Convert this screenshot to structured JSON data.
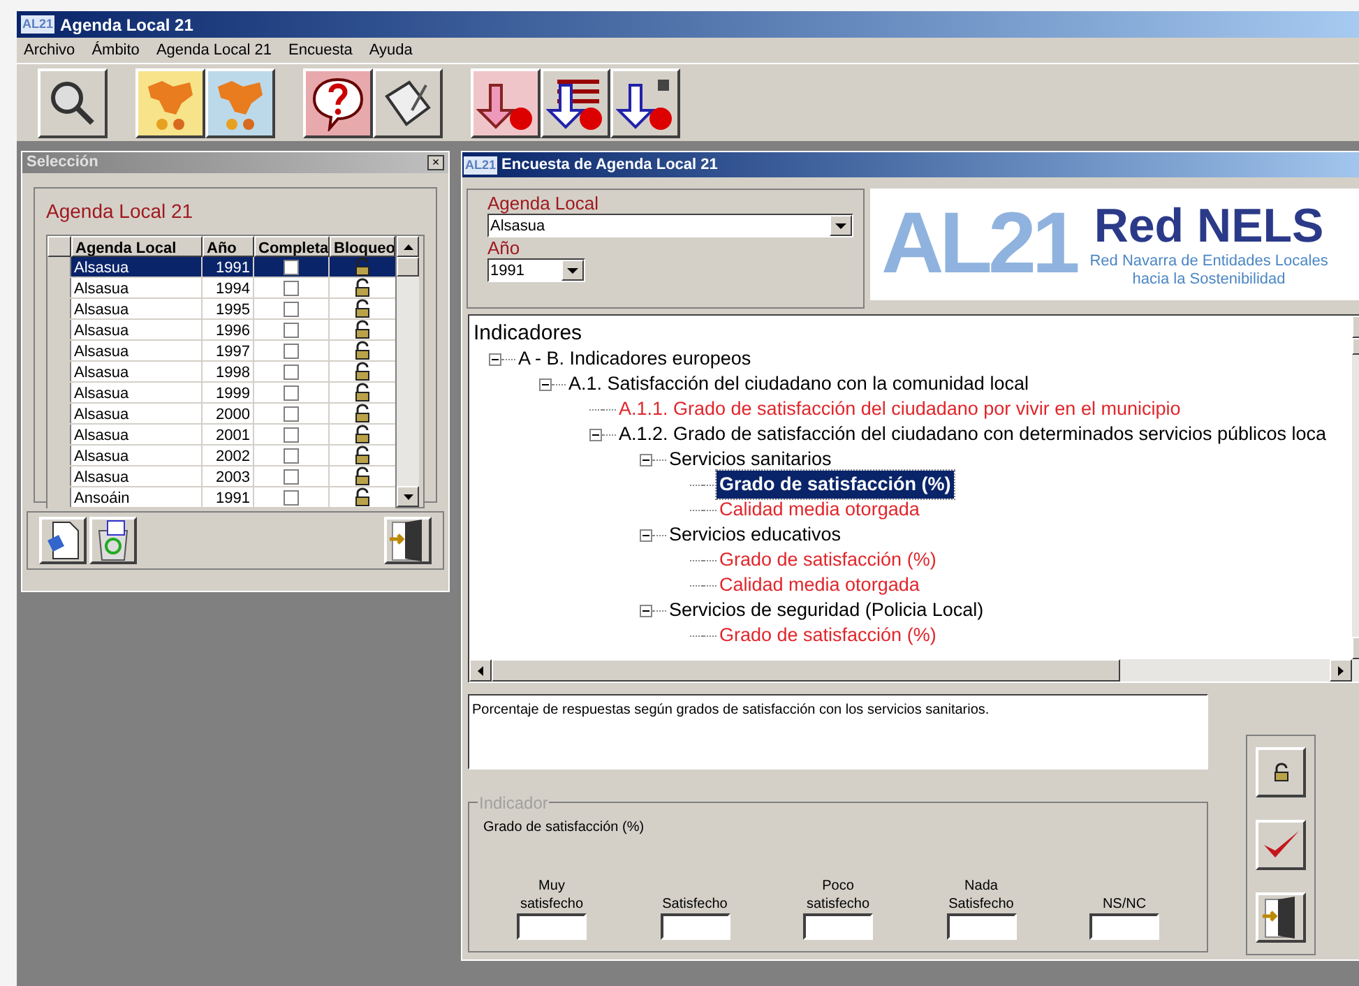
{
  "window": {
    "title": "Agenda Local 21",
    "logo": "AL21"
  },
  "menu": [
    "Archivo",
    "Ámbito",
    "Agenda Local 21",
    "Encuesta",
    "Ayuda"
  ],
  "selection_panel": {
    "title": "Selección",
    "close": "×",
    "group_title": "Agenda Local 21",
    "columns": [
      "Agenda Local",
      "Año",
      "Completa",
      "Bloqueo"
    ],
    "rows": [
      {
        "name": "Alsasua",
        "year": "1991",
        "complete": false,
        "locked": false,
        "selected": true
      },
      {
        "name": "Alsasua",
        "year": "1994",
        "complete": false,
        "locked": false,
        "selected": false
      },
      {
        "name": "Alsasua",
        "year": "1995",
        "complete": false,
        "locked": false,
        "selected": false
      },
      {
        "name": "Alsasua",
        "year": "1996",
        "complete": false,
        "locked": false,
        "selected": false
      },
      {
        "name": "Alsasua",
        "year": "1997",
        "complete": false,
        "locked": false,
        "selected": false
      },
      {
        "name": "Alsasua",
        "year": "1998",
        "complete": false,
        "locked": false,
        "selected": false
      },
      {
        "name": "Alsasua",
        "year": "1999",
        "complete": false,
        "locked": false,
        "selected": false
      },
      {
        "name": "Alsasua",
        "year": "2000",
        "complete": false,
        "locked": false,
        "selected": false
      },
      {
        "name": "Alsasua",
        "year": "2001",
        "complete": false,
        "locked": false,
        "selected": false
      },
      {
        "name": "Alsasua",
        "year": "2002",
        "complete": false,
        "locked": false,
        "selected": false
      },
      {
        "name": "Alsasua",
        "year": "2003",
        "complete": false,
        "locked": false,
        "selected": false
      },
      {
        "name": "Ansoáin",
        "year": "1991",
        "complete": false,
        "locked": false,
        "selected": false
      }
    ]
  },
  "survey_window": {
    "title": "Encuesta de Agenda Local 21",
    "logo": "AL21",
    "agenda_label": "Agenda Local",
    "agenda_value": "Alsasua",
    "year_label": "Año",
    "year_value": "1991",
    "banner": {
      "mark": "AL21",
      "name": "Red NELS",
      "line1": "Red Navarra de Entidades Locales",
      "line2": "hacia la Sostenibilidad"
    },
    "tree": {
      "label": "Indicadores",
      "children": [
        {
          "label": "A - B. Indicadores europeos",
          "expanded": true,
          "selected": false,
          "color": "#000000",
          "children": [
            {
              "label": "A.1. Satisfacción del ciudadano con la comunidad local",
              "expanded": true,
              "selected": false,
              "color": "#000000",
              "children": [
                {
                  "label": "A.1.1. Grado de satisfacción del ciudadano por vivir en el municipio",
                  "expanded": false,
                  "selected": false,
                  "color": "#e0262b"
                },
                {
                  "label": "A.1.2. Grado de satisfacción del ciudadano con determinados servicios públicos loca",
                  "expanded": true,
                  "selected": false,
                  "color": "#000000",
                  "children": [
                    {
                      "label": "Servicios sanitarios",
                      "expanded": true,
                      "selected": false,
                      "color": "#000000",
                      "children": [
                        {
                          "label": "Grado de satisfacción (%)",
                          "expanded": false,
                          "selected": true
                        },
                        {
                          "label": "Calidad media otorgada",
                          "expanded": false,
                          "selected": false,
                          "color": "#e0262b"
                        }
                      ]
                    },
                    {
                      "label": "Servicios educativos",
                      "expanded": true,
                      "selected": false,
                      "color": "#000000",
                      "children": [
                        {
                          "label": "Grado de satisfacción (%)",
                          "expanded": false,
                          "selected": false,
                          "color": "#e0262b"
                        },
                        {
                          "label": "Calidad media otorgada",
                          "expanded": false,
                          "selected": false,
                          "color": "#e0262b"
                        }
                      ]
                    },
                    {
                      "label": "Servicios de seguridad (Policia Local)",
                      "expanded": true,
                      "selected": false,
                      "color": "#000000",
                      "children": [
                        {
                          "label": "Grado de satisfacción (%)",
                          "expanded": false,
                          "selected": false,
                          "color": "#e0262b"
                        }
                      ]
                    }
                  ]
                }
              ]
            }
          ]
        }
      ]
    },
    "description": "Porcentaje de respuestas según grados de satisfacción con los servicios sanitarios.",
    "indicator": {
      "legend": "Indicador",
      "name": "Grado de satisfacción (%)",
      "fields": [
        {
          "label": "Muy satisfecho"
        },
        {
          "label": "Satisfecho"
        },
        {
          "label": "Poco satisfecho"
        },
        {
          "label": "Nada Satisfecho"
        },
        {
          "label": "NS/NC"
        }
      ]
    }
  }
}
